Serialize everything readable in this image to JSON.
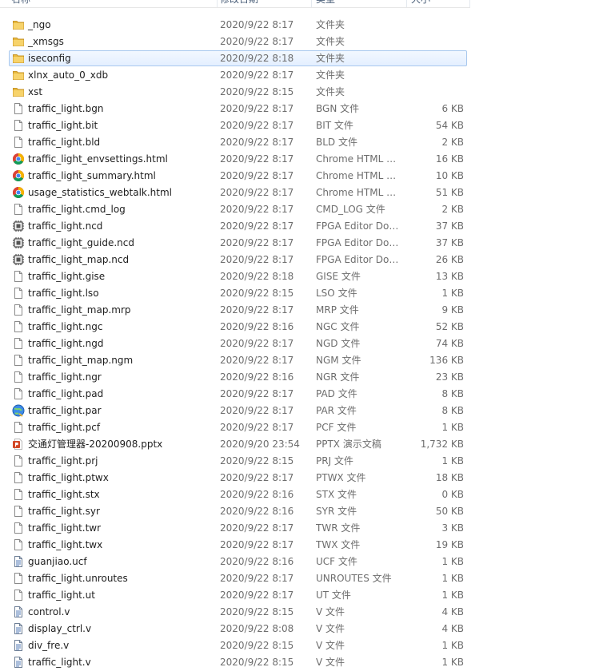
{
  "columns": {
    "name": "名称",
    "date": "修改日期",
    "type": "类型",
    "size": "大小"
  },
  "files": [
    {
      "name": "_ngo",
      "date": "2020/9/22 8:17",
      "type": "文件夹",
      "size": "",
      "icon": "folder-icon"
    },
    {
      "name": "_xmsgs",
      "date": "2020/9/22 8:17",
      "type": "文件夹",
      "size": "",
      "icon": "folder-icon"
    },
    {
      "name": "iseconfig",
      "date": "2020/9/22 8:18",
      "type": "文件夹",
      "size": "",
      "icon": "folder-icon",
      "selected": true
    },
    {
      "name": "xlnx_auto_0_xdb",
      "date": "2020/9/22 8:17",
      "type": "文件夹",
      "size": "",
      "icon": "folder-icon"
    },
    {
      "name": "xst",
      "date": "2020/9/22 8:15",
      "type": "文件夹",
      "size": "",
      "icon": "folder-icon"
    },
    {
      "name": "traffic_light.bgn",
      "date": "2020/9/22 8:17",
      "type": "BGN 文件",
      "size": "6 KB",
      "icon": "file-icon"
    },
    {
      "name": "traffic_light.bit",
      "date": "2020/9/22 8:17",
      "type": "BIT 文件",
      "size": "54 KB",
      "icon": "file-icon"
    },
    {
      "name": "traffic_light.bld",
      "date": "2020/9/22 8:17",
      "type": "BLD 文件",
      "size": "2 KB",
      "icon": "file-icon"
    },
    {
      "name": "traffic_light_envsettings.html",
      "date": "2020/9/22 8:17",
      "type": "Chrome HTML D...",
      "size": "16 KB",
      "icon": "chrome-icon"
    },
    {
      "name": "traffic_light_summary.html",
      "date": "2020/9/22 8:17",
      "type": "Chrome HTML D...",
      "size": "10 KB",
      "icon": "chrome-icon"
    },
    {
      "name": "usage_statistics_webtalk.html",
      "date": "2020/9/22 8:17",
      "type": "Chrome HTML D...",
      "size": "51 KB",
      "icon": "chrome-icon"
    },
    {
      "name": "traffic_light.cmd_log",
      "date": "2020/9/22 8:17",
      "type": "CMD_LOG 文件",
      "size": "2 KB",
      "icon": "file-icon"
    },
    {
      "name": "traffic_light.ncd",
      "date": "2020/9/22 8:17",
      "type": "FPGA Editor Doc...",
      "size": "37 KB",
      "icon": "fpga-editor-icon"
    },
    {
      "name": "traffic_light_guide.ncd",
      "date": "2020/9/22 8:17",
      "type": "FPGA Editor Doc...",
      "size": "37 KB",
      "icon": "fpga-editor-icon"
    },
    {
      "name": "traffic_light_map.ncd",
      "date": "2020/9/22 8:17",
      "type": "FPGA Editor Doc...",
      "size": "26 KB",
      "icon": "fpga-editor-icon"
    },
    {
      "name": "traffic_light.gise",
      "date": "2020/9/22 8:18",
      "type": "GISE 文件",
      "size": "13 KB",
      "icon": "file-icon"
    },
    {
      "name": "traffic_light.lso",
      "date": "2020/9/22 8:15",
      "type": "LSO 文件",
      "size": "1 KB",
      "icon": "file-icon"
    },
    {
      "name": "traffic_light_map.mrp",
      "date": "2020/9/22 8:17",
      "type": "MRP 文件",
      "size": "9 KB",
      "icon": "file-icon"
    },
    {
      "name": "traffic_light.ngc",
      "date": "2020/9/22 8:16",
      "type": "NGC 文件",
      "size": "52 KB",
      "icon": "file-icon"
    },
    {
      "name": "traffic_light.ngd",
      "date": "2020/9/22 8:17",
      "type": "NGD 文件",
      "size": "74 KB",
      "icon": "file-icon"
    },
    {
      "name": "traffic_light_map.ngm",
      "date": "2020/9/22 8:17",
      "type": "NGM 文件",
      "size": "136 KB",
      "icon": "file-icon"
    },
    {
      "name": "traffic_light.ngr",
      "date": "2020/9/22 8:16",
      "type": "NGR 文件",
      "size": "23 KB",
      "icon": "file-icon"
    },
    {
      "name": "traffic_light.pad",
      "date": "2020/9/22 8:17",
      "type": "PAD 文件",
      "size": "8 KB",
      "icon": "file-icon"
    },
    {
      "name": "traffic_light.par",
      "date": "2020/9/22 8:17",
      "type": "PAR 文件",
      "size": "8 KB",
      "icon": "par-globe-icon"
    },
    {
      "name": "traffic_light.pcf",
      "date": "2020/9/22 8:17",
      "type": "PCF 文件",
      "size": "1 KB",
      "icon": "file-icon"
    },
    {
      "name": "交通灯管理器-20200908.pptx",
      "date": "2020/9/20 23:54",
      "type": "PPTX 演示文稿",
      "size": "1,732 KB",
      "icon": "powerpoint-icon"
    },
    {
      "name": "traffic_light.prj",
      "date": "2020/9/22 8:15",
      "type": "PRJ 文件",
      "size": "1 KB",
      "icon": "file-icon"
    },
    {
      "name": "traffic_light.ptwx",
      "date": "2020/9/22 8:17",
      "type": "PTWX 文件",
      "size": "18 KB",
      "icon": "file-icon"
    },
    {
      "name": "traffic_light.stx",
      "date": "2020/9/22 8:16",
      "type": "STX 文件",
      "size": "0 KB",
      "icon": "file-icon"
    },
    {
      "name": "traffic_light.syr",
      "date": "2020/9/22 8:16",
      "type": "SYR 文件",
      "size": "50 KB",
      "icon": "file-icon"
    },
    {
      "name": "traffic_light.twr",
      "date": "2020/9/22 8:17",
      "type": "TWR 文件",
      "size": "3 KB",
      "icon": "file-icon"
    },
    {
      "name": "traffic_light.twx",
      "date": "2020/9/22 8:17",
      "type": "TWX 文件",
      "size": "19 KB",
      "icon": "file-icon"
    },
    {
      "name": "guanjiao.ucf",
      "date": "2020/9/22 8:16",
      "type": "UCF 文件",
      "size": "1 KB",
      "icon": "text-file-icon"
    },
    {
      "name": "traffic_light.unroutes",
      "date": "2020/9/22 8:17",
      "type": "UNROUTES 文件",
      "size": "1 KB",
      "icon": "file-icon"
    },
    {
      "name": "traffic_light.ut",
      "date": "2020/9/22 8:17",
      "type": "UT 文件",
      "size": "1 KB",
      "icon": "file-icon"
    },
    {
      "name": "control.v",
      "date": "2020/9/22 8:15",
      "type": "V 文件",
      "size": "4 KB",
      "icon": "text-file-icon"
    },
    {
      "name": "display_ctrl.v",
      "date": "2020/9/22 8:08",
      "type": "V 文件",
      "size": "4 KB",
      "icon": "text-file-icon"
    },
    {
      "name": "div_fre.v",
      "date": "2020/9/22 8:15",
      "type": "V 文件",
      "size": "1 KB",
      "icon": "text-file-icon"
    },
    {
      "name": "traffic_light.v",
      "date": "2020/9/22 8:15",
      "type": "V 文件",
      "size": "1 KB",
      "icon": "text-file-icon"
    }
  ]
}
